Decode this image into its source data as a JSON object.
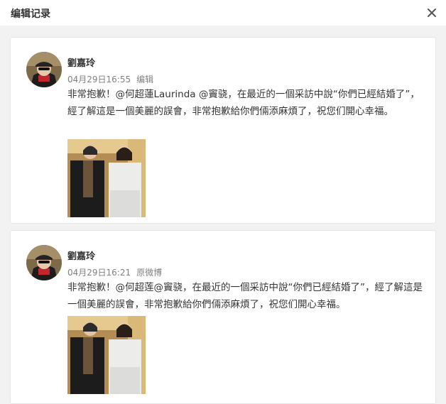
{
  "header": {
    "title": "编辑记录",
    "close_icon": "close-icon"
  },
  "records": [
    {
      "author": "劉嘉玲",
      "time": "04月29日16:55",
      "tag": "编辑",
      "text": "非常抱歉！@何超蓮Laurinda @竇骁，在最近的一個采訪中說“你們已經結婚了”，經了解這是一個美麗的誤會，非常抱歉給你們倆添麻煩了，祝您们開心幸福。",
      "image": "photo-two-women"
    },
    {
      "author": "劉嘉玲",
      "time": "04月29日16:21",
      "tag": "原微博",
      "text": "非常抱歉！@何超莲@竇骁，在最近的一個采訪中說“你們已經結婚了”，經了解這是一個美麗的誤會，非常抱歉給你們倆添麻煩了，祝您们開心幸福。",
      "image": "photo-two-women"
    }
  ]
}
